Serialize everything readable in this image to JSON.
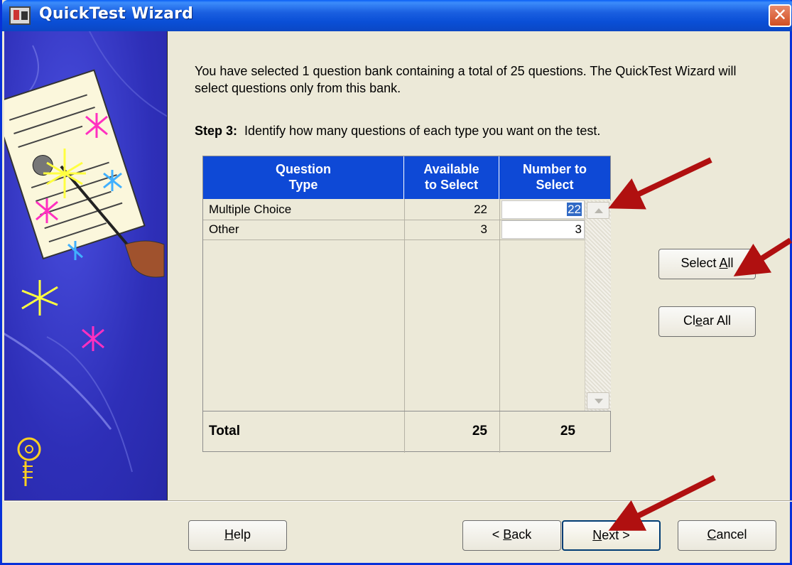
{
  "window": {
    "title": "QuickTest Wizard",
    "close_symbol": "✕"
  },
  "intro": {
    "text": "You have selected 1 question bank containing a total of 25 questions.  The QuickTest Wizard will select questions only from this bank."
  },
  "step": {
    "label": "Step 3:",
    "text": "Identify how many questions of each type you want on the test."
  },
  "grid": {
    "headers": {
      "type_line1": "Question",
      "type_line2": "Type",
      "available_line1": "Available",
      "available_line2": "to Select",
      "number_line1": "Number to",
      "number_line2": "Select"
    },
    "rows": [
      {
        "type": "Multiple Choice",
        "available": "22",
        "number": "22"
      },
      {
        "type": "Other",
        "available": "3",
        "number": "3"
      }
    ],
    "total": {
      "label": "Total",
      "available": "25",
      "number": "25"
    }
  },
  "side_buttons": {
    "select_all_pre": "Select ",
    "select_all_mnemonic": "A",
    "select_all_post": "ll",
    "clear_all_pre": "Cl",
    "clear_all_mnemonic": "e",
    "clear_all_post": "ar All"
  },
  "footer": {
    "help_mnemonic": "H",
    "help_rest": "elp",
    "back_pre": "< ",
    "back_mnemonic": "B",
    "back_rest": "ack",
    "next_mnemonic": "N",
    "next_rest": "ext >",
    "cancel_mnemonic": "C",
    "cancel_rest": "ancel"
  },
  "colors": {
    "titlebar": "#0a4fd6",
    "grid_header": "#0e49d6",
    "annotation_arrow": "#b01010",
    "window_bg": "#ece9d8"
  },
  "icons": [
    "app-icon",
    "close-icon",
    "scroll-up-icon",
    "scroll-down-icon",
    "lightbulb-icon"
  ]
}
